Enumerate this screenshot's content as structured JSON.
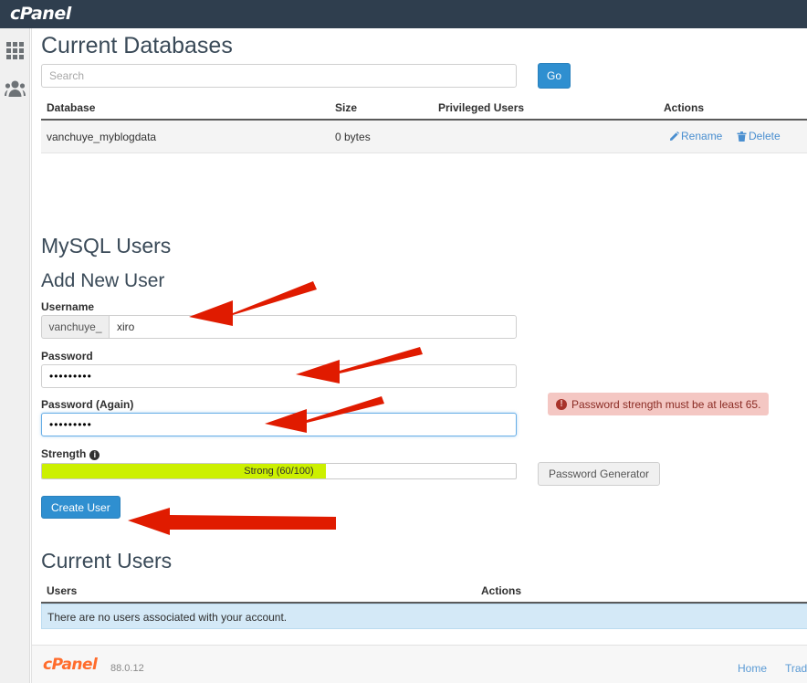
{
  "header": {
    "logo": "cPanel"
  },
  "sidebar": {
    "items": [
      {
        "name": "apps-grid",
        "icon": "grid-icon"
      },
      {
        "name": "users",
        "icon": "people-icon"
      }
    ]
  },
  "current_databases": {
    "heading": "Current Databases",
    "search": {
      "placeholder": "Search",
      "value": ""
    },
    "go_label": "Go",
    "columns": [
      "Database",
      "Size",
      "Privileged Users",
      "Actions"
    ],
    "rows": [
      {
        "database": "vanchuye_myblogdata",
        "size": "0 bytes",
        "privileged_users": "",
        "actions": [
          "Rename",
          "Delete"
        ]
      }
    ]
  },
  "mysql_users": {
    "heading": "MySQL Users",
    "add_new_user": {
      "heading": "Add New User",
      "username_label": "Username",
      "username_prefix": "vanchuye_",
      "username_value": "xiro",
      "password_label": "Password",
      "password_value": "•••••••••",
      "password_again_label": "Password (Again)",
      "password_again_value": "•••••••••",
      "password_error": "Password strength must be at least 65.",
      "strength_label": "Strength",
      "strength_text": "Strong (60/100)",
      "strength_percent": 60,
      "strength_color": "#ccf000",
      "password_generator_label": "Password Generator",
      "create_user_label": "Create User"
    }
  },
  "current_users": {
    "heading": "Current Users",
    "columns": [
      "Users",
      "Actions"
    ],
    "empty_message": "There are no users associated with your account."
  },
  "footer": {
    "logo": "cPanel",
    "version": "88.0.12",
    "links": [
      "Home",
      "Trad"
    ]
  },
  "colors": {
    "topbar": "#2f3e4e",
    "accent_blue": "#2f8fd0",
    "link_blue": "#4a8fd0",
    "error_bg": "#f4c7c3",
    "error_text": "#8a2b24",
    "info_bg": "#d4e9f7",
    "brand_orange": "#ff6c2c",
    "strength_fill": "#ccf000"
  }
}
